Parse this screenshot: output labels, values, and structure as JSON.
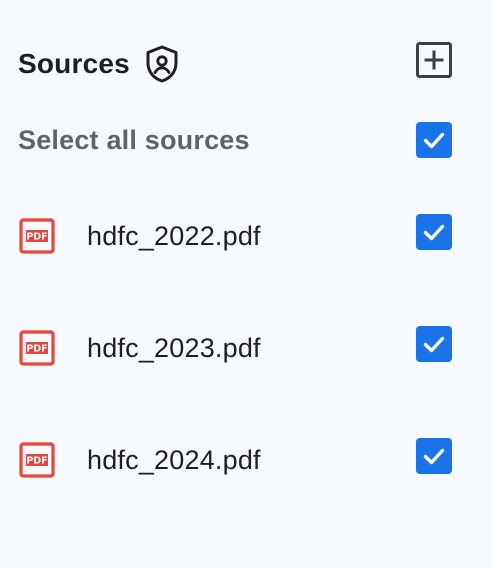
{
  "header": {
    "title": "Sources",
    "shield_icon": "shield-person-icon",
    "add_icon": "add-box-icon"
  },
  "select_all": {
    "label": "Select all sources",
    "checked": true
  },
  "sources": [
    {
      "name": "hdfc_2022.pdf",
      "icon": "pdf-icon",
      "checked": true
    },
    {
      "name": "hdfc_2023.pdf",
      "icon": "pdf-icon",
      "checked": true
    },
    {
      "name": "hdfc_2024.pdf",
      "icon": "pdf-icon",
      "checked": true
    }
  ],
  "colors": {
    "background": "#f6f9fe",
    "checkbox": "#1a73e8",
    "pdf_red": "#e8453c",
    "muted_text": "#5f6368",
    "text": "#1f1f1f"
  }
}
